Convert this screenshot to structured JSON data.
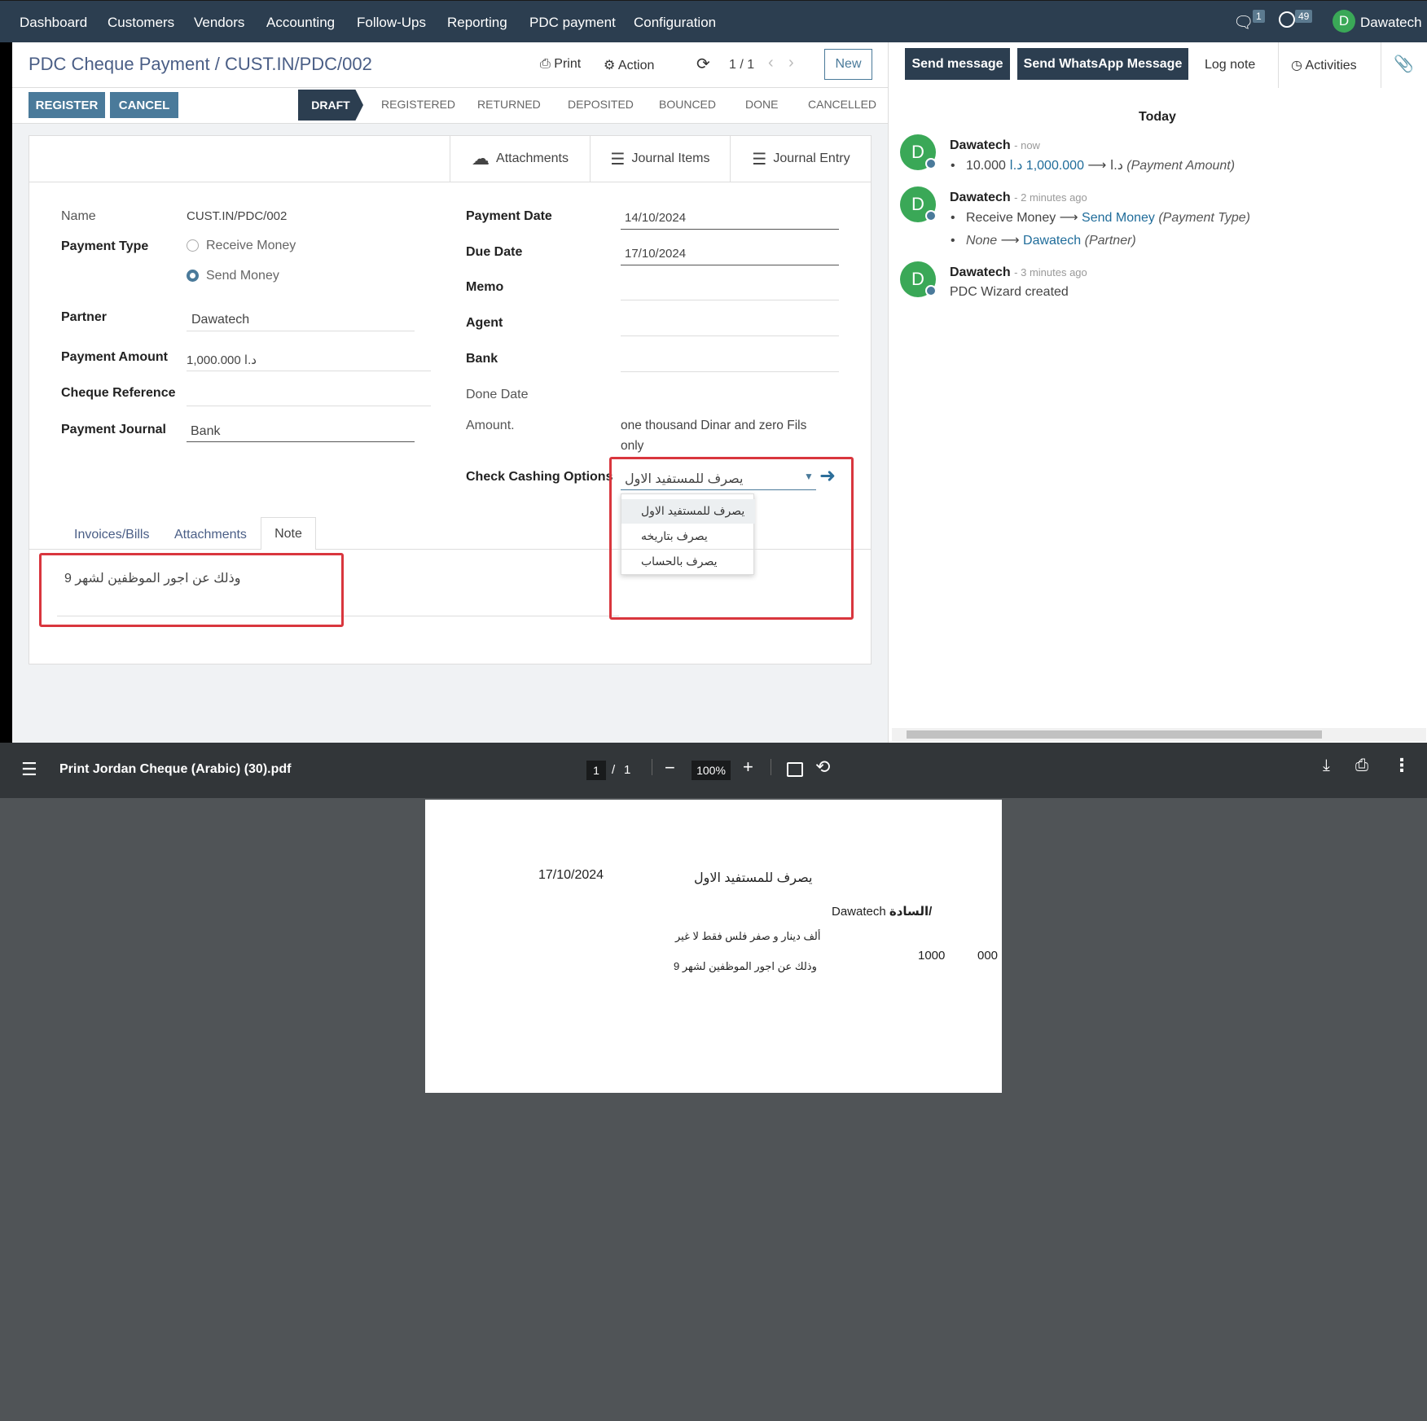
{
  "nav": {
    "items": [
      "Dashboard",
      "Customers",
      "Vendors",
      "Accounting",
      "Follow-Ups",
      "Reporting",
      "PDC payment",
      "Configuration"
    ],
    "messages_count": "1",
    "activities_count": "49",
    "user_initial": "D",
    "user_name": "Dawatech"
  },
  "header": {
    "breadcrumb_parent": "PDC Cheque Payment",
    "breadcrumb_sep": "/",
    "record_name": "CUST.IN/PDC/002",
    "print_label": "Print",
    "action_label": "Action",
    "pager": "1 / 1",
    "new_label": "New"
  },
  "buttons": {
    "register": "REGISTER",
    "cancel": "CANCEL"
  },
  "statusbar": [
    "DRAFT",
    "REGISTERED",
    "RETURNED",
    "DEPOSITED",
    "BOUNCED",
    "DONE",
    "CANCELLED"
  ],
  "smart_buttons": {
    "attachments": "Attachments",
    "journal_items": "Journal Items",
    "journal_entry": "Journal Entry"
  },
  "form": {
    "name_label": "Name",
    "name_value": "CUST.IN/PDC/002",
    "payment_type_label": "Payment Type",
    "payment_type_options": [
      "Receive Money",
      "Send Money"
    ],
    "partner_label": "Partner",
    "partner_value": "Dawatech",
    "amount_label": "Payment Amount",
    "amount_value": "د.ا 1,000.000",
    "cheque_ref_label": "Cheque Reference",
    "journal_label": "Payment Journal",
    "journal_value": "Bank",
    "payment_date_label": "Payment Date",
    "payment_date_value": "14/10/2024",
    "due_date_label": "Due Date",
    "due_date_value": "17/10/2024",
    "memo_label": "Memo",
    "agent_label": "Agent",
    "bank_label": "Bank",
    "done_date_label": "Done Date",
    "amount_words_label": "Amount.",
    "amount_words_line1": "one thousand Dinar and zero Fils",
    "amount_words_line2": "only",
    "cashing_label": "Check Cashing Options",
    "cashing_value": "يصرف للمستفيد الاول",
    "cashing_options": [
      "يصرف للمستفيد الاول",
      "يصرف بتاريخه",
      "يصرف بالحساب"
    ]
  },
  "tabs": {
    "items": [
      "Invoices/Bills",
      "Attachments",
      "Note"
    ],
    "note_text": "وذلك عن اجور الموظفين لشهر 9"
  },
  "chatter": {
    "send_message": "Send message",
    "send_whatsapp": "Send WhatsApp Message",
    "log_note": "Log note",
    "activities": "Activities",
    "today": "Today",
    "messages": [
      {
        "author": "Dawatech",
        "ago": "- now",
        "old": "10.000 د.ا",
        "new": "1,000.000 د.ا",
        "field": "(Payment Amount)"
      },
      {
        "author": "Dawatech",
        "ago": "- 2 minutes ago",
        "old": "Receive Money",
        "new": "Send Money",
        "field": "(Payment Type)",
        "old2": "None",
        "new2": "Dawatech",
        "field2": "(Partner)"
      },
      {
        "author": "Dawatech",
        "ago": "- 3 minutes ago",
        "body": "PDC Wizard created"
      }
    ]
  },
  "pdf": {
    "filename": "Print Jordan Cheque (Arabic) (30).pdf",
    "page_current": "1",
    "page_sep": "/",
    "page_total": "1",
    "zoom": "100%",
    "date": "17/10/2024",
    "cashing": "يصرف للمستفيد الاول",
    "to_label": "السادة/",
    "to_value": "Dawatech",
    "amount_words": "ألف دينار و صفر فلس فقط لا غير",
    "amount_num": "1000",
    "amount_fils": "000",
    "note": "وذلك عن اجور الموظفين لشهر 9"
  },
  "colors": {
    "navbar": "#2c3e50",
    "accent": "#4a7a9a",
    "highlight": "#d9363e",
    "avatar": "#3aa857"
  }
}
